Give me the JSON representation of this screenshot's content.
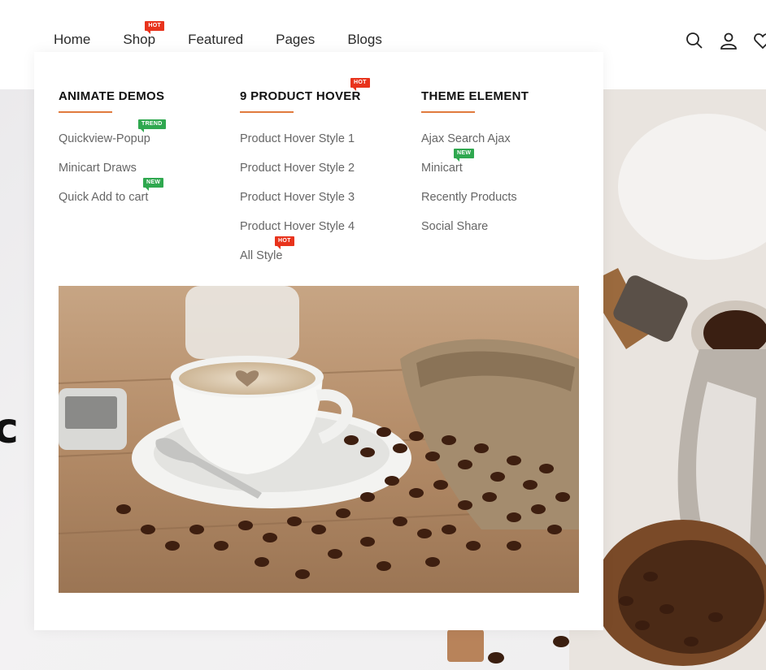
{
  "header": {
    "nav": [
      {
        "label": "Home",
        "badge": ""
      },
      {
        "label": "Shop",
        "badge": "HOT"
      },
      {
        "label": "Featured",
        "badge": ""
      },
      {
        "label": "Pages",
        "badge": ""
      },
      {
        "label": "Blogs",
        "badge": ""
      }
    ],
    "icons": [
      "search-icon",
      "user-icon",
      "heart-icon"
    ]
  },
  "hero": {
    "partial_text": "c"
  },
  "mega_menu": {
    "columns": [
      {
        "title": "ANIMATE DEMOS",
        "title_badge": "",
        "links": [
          {
            "label": "Quickview-Popup",
            "badge": "TREND"
          },
          {
            "label": "Minicart Draws",
            "badge": ""
          },
          {
            "label": "Quick Add to cart",
            "badge": "NEW"
          }
        ]
      },
      {
        "title": "9 PRODUCT HOVER",
        "title_badge": "HOT",
        "links": [
          {
            "label": "Product Hover Style 1",
            "badge": ""
          },
          {
            "label": "Product Hover Style 2",
            "badge": ""
          },
          {
            "label": "Product Hover Style 3",
            "badge": ""
          },
          {
            "label": "Product Hover Style 4",
            "badge": ""
          },
          {
            "label": "All Style",
            "badge": "HOT"
          }
        ]
      },
      {
        "title": "THEME ELEMENT",
        "title_badge": "",
        "links": [
          {
            "label": "Ajax Search Ajax",
            "badge": ""
          },
          {
            "label": "Minicart",
            "badge": "NEW"
          },
          {
            "label": "Recently Products",
            "badge": ""
          },
          {
            "label": "Social Share",
            "badge": ""
          }
        ]
      }
    ],
    "promo_image": "coffee-cup-and-beans-image"
  },
  "colors": {
    "accent_underline": "#e07a3d",
    "badge_hot": "#e8331c",
    "badge_new": "#2fa84f",
    "badge_trend": "#2fa84f"
  }
}
